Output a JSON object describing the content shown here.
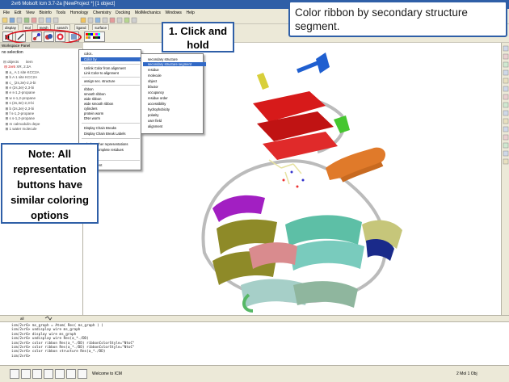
{
  "window": {
    "title": "2vr6 Molsoft Icm 3.7-2a  [NewProject *] [1 object]"
  },
  "menubar": [
    "File",
    "Edit",
    "View",
    "Bioinfo",
    "Tools",
    "Homology",
    "Chemistry",
    "Docking",
    "MolMechanics",
    "Windows",
    "Help"
  ],
  "tabs": [
    "display",
    "mol",
    "mesh",
    "search",
    "ligand",
    "surface"
  ],
  "workspace": {
    "header": "Workspace Panel",
    "selection": "no selection",
    "tree": [
      "objects",
      "2vr6",
      "a_",
      "b",
      "c_",
      "e",
      "e",
      "w",
      "s",
      "b",
      "f",
      "s",
      "m",
      "calmodulin depe",
      "1 water molecule"
    ],
    "tree_right": [
      "item",
      "XR, 2.3A",
      "A 1 site KCC2A",
      "A 1 site KCC2A",
      "(2s,3e)-2,3-bi",
      "(2s,3e)-2,3-bi",
      "s-1,2-propane",
      "s-1,2-propane",
      "(2s,3e)-2,3-bi",
      "(2s,3e)-2,3-bi",
      "s-1,2-propane",
      "s-1,2-propane"
    ]
  },
  "dropdown_menu": {
    "items": [
      "color..",
      "Color by",
      "Unlink Color from alignment",
      "Link Color to alignment",
      "assign sec. structure",
      "ribbon",
      "smooth ribbon",
      "wide ribbon",
      "wide smooth ribbon",
      "cylinders",
      "protein worm",
      "DNA worm",
      "Display Chain Breaks",
      "Display Chain Break Labels",
      "Display other representations",
      "Display complete residues",
      "Select",
      "Transparent"
    ]
  },
  "submenu": {
    "items": [
      "secondary structure",
      "secondary structure segment",
      "residue",
      "molecule",
      "object",
      "bfactor",
      "occupancy",
      "residue order",
      "accessibility",
      "hydrophobicity",
      "polarity",
      "user field",
      "alignment"
    ],
    "highlighted": "secondary structure segment"
  },
  "callouts": {
    "top": "Color ribbon by secondary structure segment.",
    "click": "1. Click and hold",
    "note": "Note: All representation buttons have similar coloring options"
  },
  "bottom_tabs": [
    "all"
  ],
  "console_lines": [
    "icm/2vr6> ms_graph = Atom( Res( ms_graph ) )",
    "icm/2vr6> undisplay wire ms_graph",
    "icm/2vr6> display wire ms_graph",
    "icm/2vr6> undisplay wire Res(a_*./DD)",
    "icm/2vr6> color ribbon Res(a_*./DD) ribbonColorStyle=\"NtoC\"",
    "icm/2vr6> color ribbon Res(a_*./DD) ribbonColorStyle=\"NtoC\"",
    "icm/2vr6> color ribbon structure Res(a_*./DD)",
    "icm/2vr6>"
  ],
  "status": {
    "welcome": "Welcome to ICM",
    "right": "2 Mol 1 Obj"
  },
  "colors": {
    "accent": "#2f5fa7",
    "highlight_oval": "#d9141e",
    "menu_highlight": "#3169c6"
  }
}
